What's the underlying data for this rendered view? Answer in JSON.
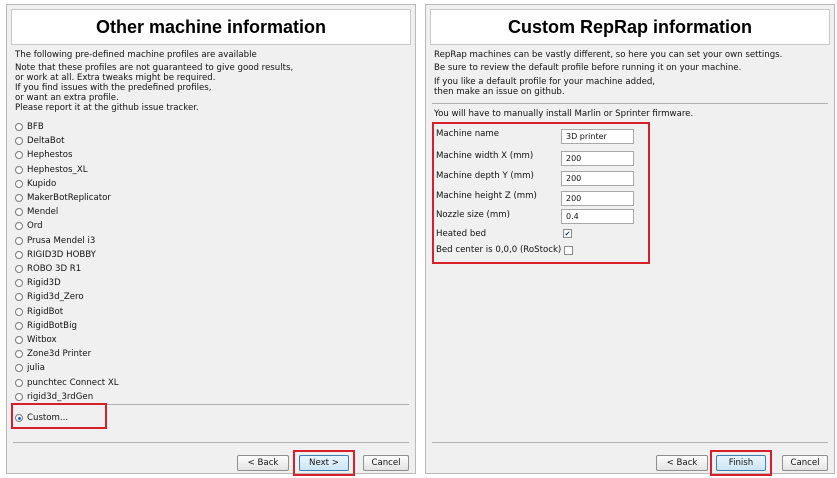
{
  "left": {
    "title": "Other machine information",
    "intro": [
      "The following pre-defined machine profiles are available",
      "Note that these profiles are not guaranteed to give good results,",
      "or work at all. Extra tweaks might be required.",
      "If you find issues with the predefined profiles,",
      "or want an extra profile.",
      "Please report it at the github issue tracker."
    ],
    "profiles": [
      "BFB",
      "DeltaBot",
      "Hephestos",
      "Hephestos_XL",
      "Kupido",
      "MakerBotReplicator",
      "Mendel",
      "Ord",
      "Prusa Mendel i3",
      "RIGID3D HOBBY",
      "ROBO 3D R1",
      "Rigid3D",
      "Rigid3d_Zero",
      "RigidBot",
      "RigidBotBig",
      "Witbox",
      "Zone3d Printer",
      "julia",
      "punchtec Connect XL",
      "rigid3d_3rdGen"
    ],
    "custom_label": "Custom...",
    "back_label": "< Back",
    "next_label": "Next >",
    "cancel_label": "Cancel"
  },
  "right": {
    "title": "Custom RepRap information",
    "intro": [
      "RepRap machines can be vastly different, so here you can set your own settings.",
      "Be sure to review the default profile before running it on your machine.",
      "If you like a default profile for your machine added,",
      "then make an issue on github."
    ],
    "firmware_note": "You will have to manually install Marlin or Sprinter firmware.",
    "fields": [
      {
        "label": "Machine name",
        "value": "3D printer"
      },
      {
        "label": "Machine width X (mm)",
        "value": "200"
      },
      {
        "label": "Machine depth Y (mm)",
        "value": "200"
      },
      {
        "label": "Machine height Z (mm)",
        "value": "200"
      },
      {
        "label": "Nozzle size (mm)",
        "value": "0.4"
      }
    ],
    "heated_bed_label": "Heated bed",
    "heated_bed_checked": true,
    "bed_center_label": "Bed center is 0,0,0 (RoStock)",
    "bed_center_checked": false,
    "back_label": "< Back",
    "finish_label": "Finish",
    "cancel_label": "Cancel"
  },
  "colors": {
    "highlight": "#d8202a",
    "panel_bg": "#f0f0f0"
  }
}
